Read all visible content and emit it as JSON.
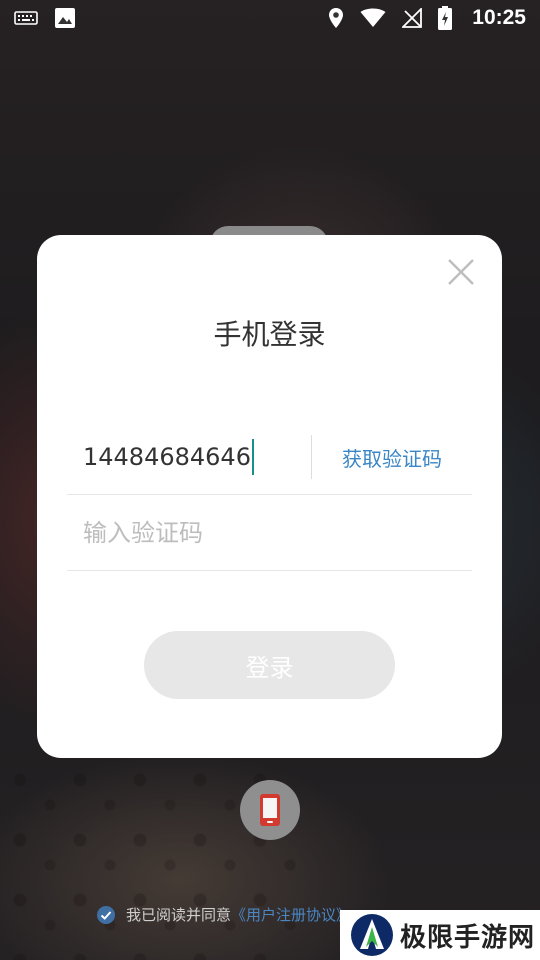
{
  "status_bar": {
    "time": "10:25"
  },
  "modal": {
    "title": "手机登录",
    "phone_value": "14484684646",
    "get_code_label": "获取验证码",
    "code_placeholder": "输入验证码",
    "login_label": "登录"
  },
  "agreement": {
    "text": "我已阅读并同意",
    "link": "《用户注册协议》"
  },
  "watermark": {
    "text": "极限手游网"
  },
  "colors": {
    "accent": "#3b86c6",
    "caret": "#1a8f8a",
    "login_disabled": "#e7e7e7"
  }
}
